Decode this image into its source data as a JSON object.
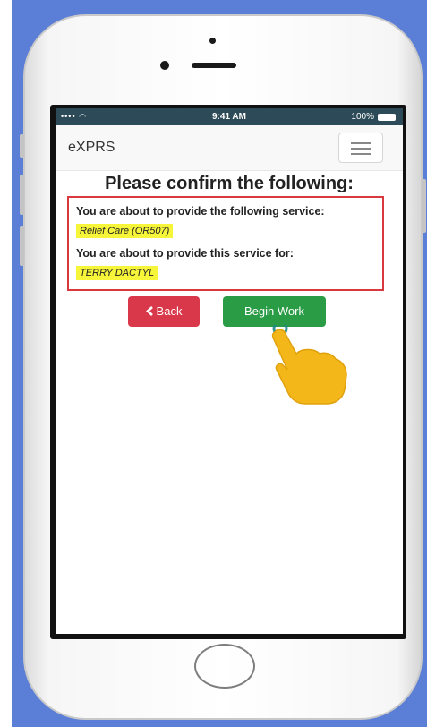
{
  "status_bar": {
    "signal": "•••• ◠",
    "time": "9:41 AM",
    "battery": "100%"
  },
  "app": {
    "brand": "eXPRS",
    "menu_icon": "hamburger-icon"
  },
  "page": {
    "title": "Please confirm the following:",
    "service_prompt": "You are about to provide the following service:",
    "service_value": "Relief Care (OR507)",
    "client_prompt": "You are about to provide this service for:",
    "client_value": "TERRY DACTYL"
  },
  "buttons": {
    "back_label": "Back",
    "back_icon": "chevron-left-icon",
    "begin_label": "Begin Work"
  },
  "colors": {
    "backdrop": "#5b7fd6",
    "back_button": "#d9384a",
    "begin_button": "#2a9c45",
    "highlight": "#f6f53a",
    "box_border": "#d9383f",
    "hand": "#f4b719"
  }
}
